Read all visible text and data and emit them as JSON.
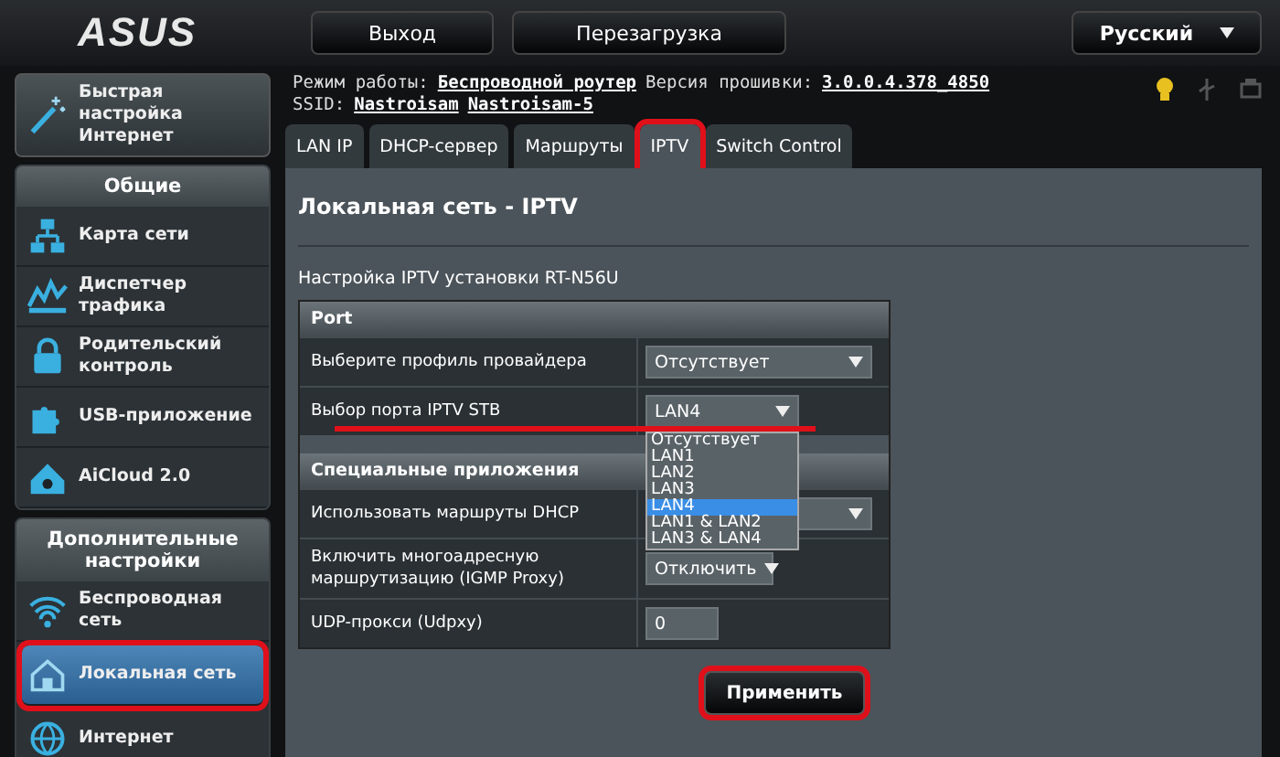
{
  "logo": "ASUS",
  "top_buttons": [
    {
      "label": "Выход"
    },
    {
      "label": "Перезагрузка"
    }
  ],
  "language": "Русский",
  "status": {
    "mode_label": "Режим работы:",
    "mode": "Беспроводной роутер",
    "firmware_label": "Версия прошивки:",
    "firmware": "3.0.0.4.378_4850",
    "ssid_label": "SSID:",
    "ssids": [
      "Nastroisam",
      "Nastroisam-5"
    ]
  },
  "quick_setup": "Быстрая настройка Интернет",
  "sidebar": [
    {
      "title": "Общие",
      "items": [
        {
          "label": "Карта сети",
          "selected": false,
          "highlighted": false
        },
        {
          "label": "Диспетчер трафика",
          "selected": false,
          "highlighted": false
        },
        {
          "label": "Родительский контроль",
          "selected": false,
          "highlighted": false
        },
        {
          "label": "USB-приложение",
          "selected": false,
          "highlighted": false
        },
        {
          "label": "AiCloud 2.0",
          "selected": false,
          "highlighted": false
        }
      ]
    },
    {
      "title": "Дополнительные настройки",
      "items": [
        {
          "label": "Беспроводная сеть",
          "selected": false,
          "highlighted": false
        },
        {
          "label": "Локальная сеть",
          "selected": true,
          "highlighted": true
        },
        {
          "label": "Интернет",
          "selected": false,
          "highlighted": false
        }
      ]
    }
  ],
  "tabs": [
    {
      "label": "LAN IP",
      "selected": false,
      "highlighted": false
    },
    {
      "label": "DHCP-сервер",
      "selected": false,
      "highlighted": false
    },
    {
      "label": "Маршруты",
      "selected": false,
      "highlighted": false
    },
    {
      "label": "IPTV",
      "selected": true,
      "highlighted": true
    },
    {
      "label": "Switch Control",
      "selected": false,
      "highlighted": false
    }
  ],
  "page_title": "Локальная сеть - IPTV",
  "subtitle": "Настройка IPTV установки RT-N56U",
  "sections": [
    {
      "title": "Port",
      "rows": [
        {
          "label": "Выберите профиль провайдера",
          "kind": "select",
          "value": "Отсутствует",
          "open": false,
          "marked": false
        },
        {
          "label": "Выбор порта IPTV STB",
          "kind": "select",
          "value": "LAN4",
          "open": true,
          "marked": true
        }
      ]
    },
    {
      "title": "Специальные приложения",
      "rows": [
        {
          "label": "Использовать маршруты DHCP",
          "kind": "select",
          "open": false,
          "marked": false
        },
        {
          "label": "Включить многоадресную маршрутизацию (IGMP Proxy)",
          "kind": "select",
          "value": "Отключить",
          "open": false,
          "marked": false
        },
        {
          "label": "UDP-прокси (Udpxy)",
          "kind": "input",
          "value": "0",
          "open": false,
          "marked": false
        }
      ]
    }
  ],
  "dropdown_options": [
    {
      "label": "Отсутствует",
      "selected": false
    },
    {
      "label": "LAN1",
      "selected": false
    },
    {
      "label": "LAN2",
      "selected": false
    },
    {
      "label": "LAN3",
      "selected": false
    },
    {
      "label": "LAN4",
      "selected": true
    },
    {
      "label": "LAN1 & LAN2",
      "selected": false
    },
    {
      "label": "LAN3 & LAN4",
      "selected": false
    }
  ],
  "apply_button": {
    "label": "Применить",
    "highlighted": true
  }
}
